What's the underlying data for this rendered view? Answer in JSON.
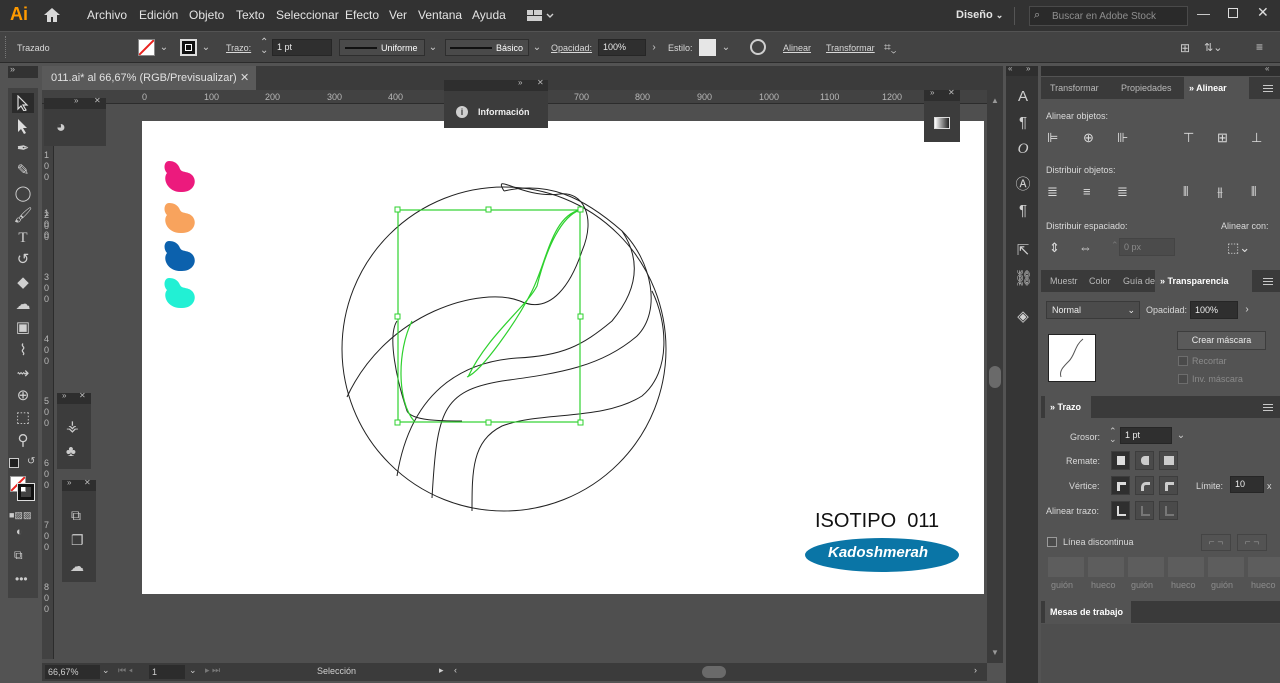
{
  "app": {
    "logo": "Ai",
    "home_icon": "home-icon"
  },
  "menu": [
    "Archivo",
    "Edición",
    "Objeto",
    "Texto",
    "Seleccionar",
    "Efecto",
    "Ver",
    "Ventana",
    "Ayuda"
  ],
  "workspace": {
    "label": "Diseño"
  },
  "search": {
    "placeholder": "Buscar en Adobe Stock"
  },
  "control": {
    "selection_label": "Trazado",
    "stroke_label": "Trazo:",
    "stroke_value": "1 pt",
    "profile_uniform": "Uniforme",
    "brush_basic": "Básico",
    "opacity_label": "Opacidad:",
    "opacity_value": "100%",
    "style_label": "Estilo:",
    "align_link": "Alinear",
    "transform_link": "Transformar"
  },
  "document": {
    "tab_title": "011.ai* al 66,67% (RGB/Previsualizar)",
    "info_panel": "Información",
    "ruler_h": [
      "0",
      "100",
      "200",
      "300",
      "400",
      "500",
      "600",
      "700",
      "800",
      "900",
      "1000",
      "1100",
      "1200"
    ],
    "ruler_v": [
      "1\n0\n0",
      "2\n0\n0",
      "3\n0\n0",
      "4\n0\n0",
      "5\n0\n0",
      "6\n0\n0",
      "7\n0\n0",
      "8\n0\n0"
    ]
  },
  "artwork": {
    "title": "ISOTIPO  011",
    "brand": "Kadoshmerah",
    "swatches": [
      "#ec1a7d",
      "#f8a35d",
      "#0c61ad",
      "#22f0d4"
    ],
    "brand_color": "#0a75a6"
  },
  "status": {
    "zoom": "66,67%",
    "artboard": "1",
    "tool": "Selección"
  },
  "panel": {
    "tabs_top": [
      "Transformar",
      "Propiedades",
      "Alinear"
    ],
    "align_objects": "Alinear objetos:",
    "distribute_objects": "Distribuir objetos:",
    "distribute_spacing": "Distribuir espaciado:",
    "align_to": "Alinear con:",
    "spacing_value": "0 px",
    "tabs_mid": [
      "Muestr",
      "Color",
      "Guía de",
      "Transparencia"
    ],
    "blend_mode": "Normal",
    "opacity_label": "Opacidad:",
    "opacity_value": "100%",
    "make_mask": "Crear máscara",
    "clip": "Recortar",
    "invert_mask": "Inv. máscara",
    "stroke_title": "Trazo",
    "weight_label": "Grosor:",
    "weight_value": "1 pt",
    "cap_label": "Remate:",
    "corner_label": "Vértice:",
    "limit_label": "Límite:",
    "limit_value": "10",
    "limit_unit": "x",
    "align_stroke_label": "Alinear trazo:",
    "dashed_label": "Línea discontinua",
    "dash_labels": [
      "guión",
      "hueco",
      "guión",
      "hueco",
      "guión",
      "hueco"
    ],
    "artboards_title": "Mesas de trabajo"
  }
}
